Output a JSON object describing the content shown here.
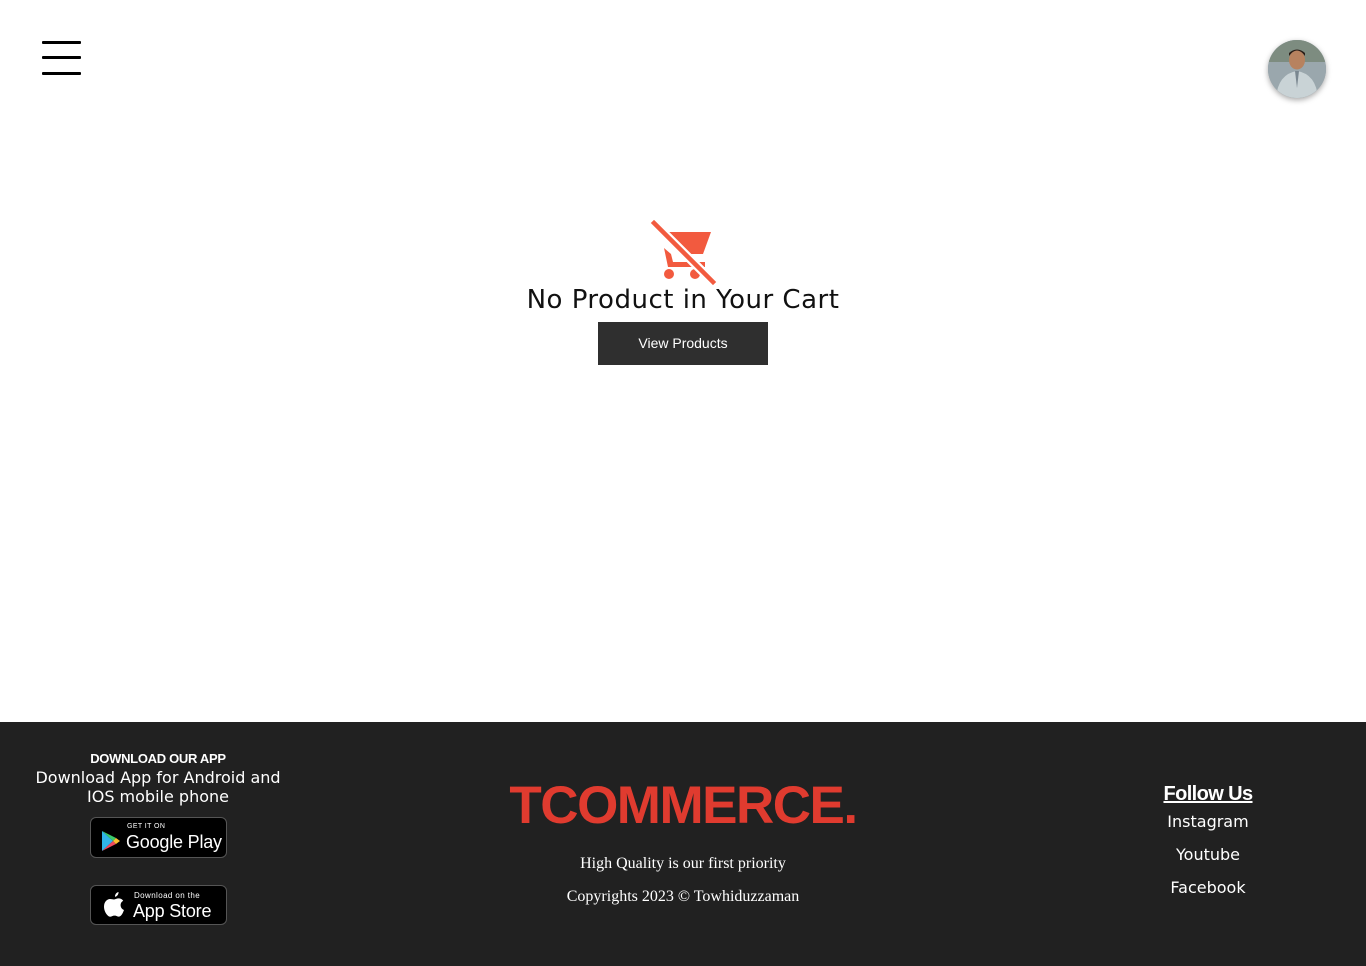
{
  "header": {
    "menu_icon": "hamburger-menu-icon",
    "avatar_icon": "user-avatar"
  },
  "cart": {
    "icon": "remove-shopping-cart-icon",
    "icon_color": "#f25a3f",
    "empty_message": "No Product in Your Cart",
    "view_products_label": "View Products"
  },
  "footer": {
    "background": "#212121",
    "download": {
      "heading": "DOWNLOAD OUR APP",
      "text": "Download App for Android and IOS mobile phone",
      "google_play": {
        "small": "GET IT ON",
        "big": "Google Play"
      },
      "app_store": {
        "small": "Download on the",
        "big": "App Store"
      }
    },
    "brand": {
      "name": "TCOMMERCE.",
      "color": "#e03b2f",
      "tagline": "High Quality is our first priority",
      "copyright": "Copyrights 2023 © Towhiduzzaman"
    },
    "follow": {
      "title": "Follow Us",
      "links": [
        "Instagram",
        "Youtube",
        "Facebook"
      ]
    }
  }
}
